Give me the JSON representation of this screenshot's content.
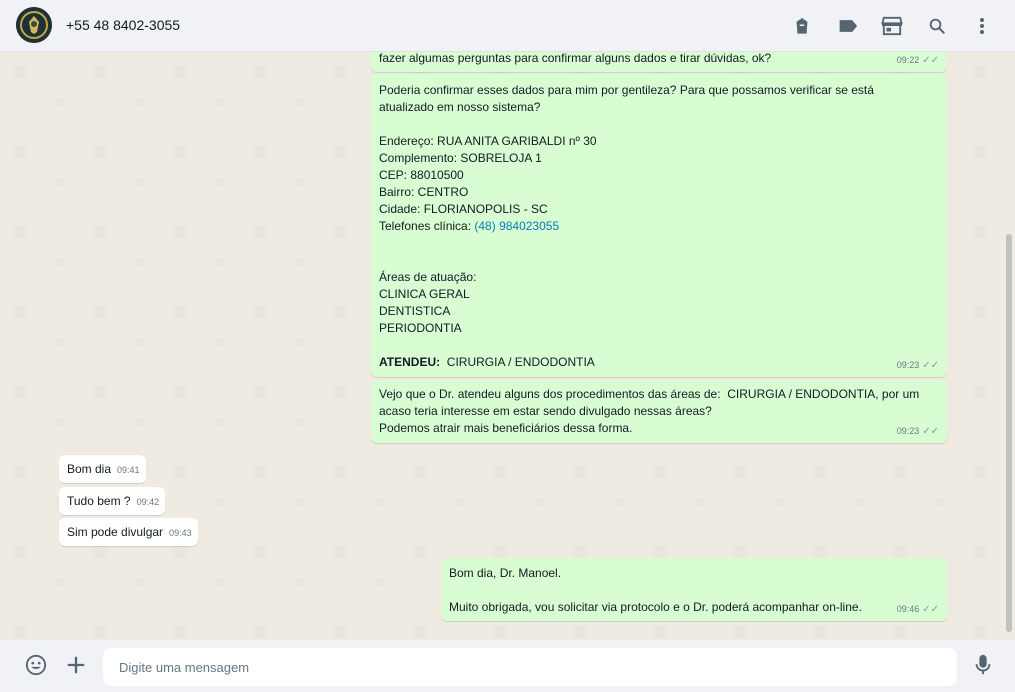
{
  "header": {
    "contact_name": "+55 48 8402-3055",
    "icons": [
      "delete-icon",
      "label-icon",
      "store-icon",
      "search-icon",
      "menu-icon"
    ]
  },
  "messages": {
    "m1": {
      "direction": "out",
      "lines": [
        "fazer algumas perguntas para confirmar alguns dados e tirar dúvidas, ok?"
      ],
      "time": "09:22"
    },
    "m2": {
      "direction": "out",
      "intro": [
        "Poderia confirmar esses dados para mim por gentileza? Para que possamos verificar se está",
        "atualizado em nosso sistema?"
      ],
      "address": [
        "Endereço: RUA ANITA GARIBALDI nº 30",
        "Complemento: SOBRELOJA 1",
        "CEP: 88010500",
        "Bairro: CENTRO",
        "Cidade: FLORIANOPOLIS - SC"
      ],
      "phone_label": "Telefones clínica: ",
      "phone_link": "(48) 984023055",
      "areas": [
        "Áreas de atuação:",
        "CLINICA GERAL",
        "DENTISTICA",
        "PERIODONTIA"
      ],
      "attended_label": "ATENDEU:",
      "attended_value": "  CIRURGIA / ENDODONTIA",
      "time": "09:23"
    },
    "m3": {
      "direction": "out",
      "lines": [
        "Vejo que o Dr. atendeu alguns dos procedimentos das áreas de:  CIRURGIA / ENDODONTIA, por um",
        "acaso teria interesse em estar sendo divulgado nessas áreas?",
        "Podemos atrair mais beneficiários dessa forma."
      ],
      "time": "09:23"
    },
    "m4": {
      "direction": "in",
      "text": "Bom dia",
      "time": "09:41"
    },
    "m5": {
      "direction": "in",
      "text": "Tudo bem ?",
      "time": "09:42"
    },
    "m6": {
      "direction": "in",
      "text": "Sim pode divulgar",
      "time": "09:43"
    },
    "m7": {
      "direction": "out",
      "lines": [
        "Bom dia, Dr. Manoel.",
        "",
        "Muito obrigada, vou solicitar via protocolo e o Dr. poderá acompanhar on-line."
      ],
      "time": "09:46"
    }
  },
  "footer": {
    "placeholder": "Digite uma mensagem",
    "icons": [
      "emoji-icon",
      "plus-icon",
      "microphone-icon"
    ]
  },
  "colors": {
    "outgoing_bubble": "#d9fdd3",
    "incoming_bubble": "#ffffff",
    "chat_background": "#efeae2",
    "link": "#027eb5"
  }
}
